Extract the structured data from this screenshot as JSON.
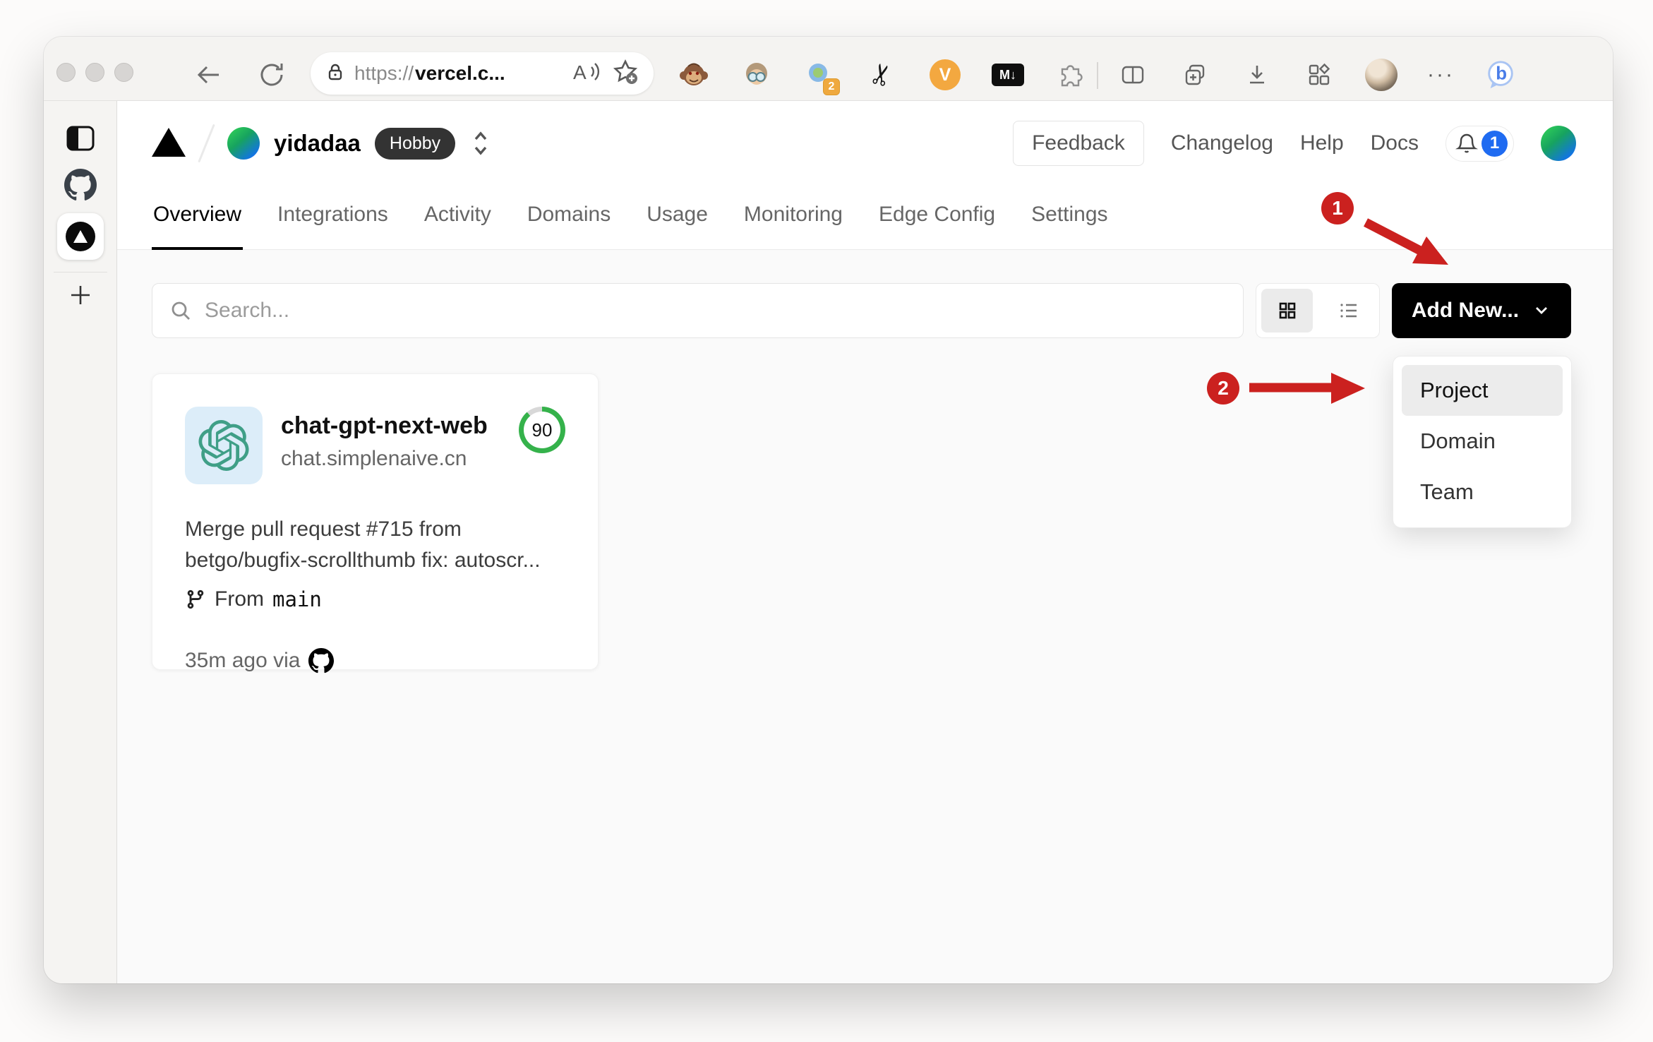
{
  "browser": {
    "url_scheme": "https://",
    "url_host": "vercel.c...",
    "icons": {
      "read_aloud_letter": "A",
      "scissors_glyph": "✂",
      "more_dots": "···",
      "bing_letter": "b"
    },
    "extensions": {
      "violentmonkey_label": "V",
      "markdown_label": "M↓",
      "translate_badge": "2"
    }
  },
  "vercel": {
    "org": "yidadaa",
    "plan": "Hobby",
    "links": {
      "feedback": "Feedback",
      "changelog": "Changelog",
      "help": "Help",
      "docs": "Docs"
    },
    "notifications": "1",
    "tabs": [
      {
        "label": "Overview",
        "active": true
      },
      {
        "label": "Integrations",
        "active": false
      },
      {
        "label": "Activity",
        "active": false
      },
      {
        "label": "Domains",
        "active": false
      },
      {
        "label": "Usage",
        "active": false
      },
      {
        "label": "Monitoring",
        "active": false
      },
      {
        "label": "Edge Config",
        "active": false
      },
      {
        "label": "Settings",
        "active": false
      }
    ],
    "search_placeholder": "Search...",
    "add_new": "Add New...",
    "dropdown": {
      "items": [
        "Project",
        "Domain",
        "Team"
      ]
    },
    "project_card": {
      "name": "chat-gpt-next-web",
      "domain": "chat.simplenaive.cn",
      "score": "90",
      "commit": "Merge pull request #715 from betgo/bugfix-scrollthumb fix: autoscr...",
      "from_label": "From",
      "branch": "main",
      "deployed_meta": "35m ago via"
    },
    "annotations": {
      "step1": "1",
      "step2": "2"
    }
  },
  "colors": {
    "annotation_red": "#cb211f",
    "notification_blue": "#1f6bf1",
    "score_green": "#35b24b",
    "brand_black": "#000000"
  }
}
